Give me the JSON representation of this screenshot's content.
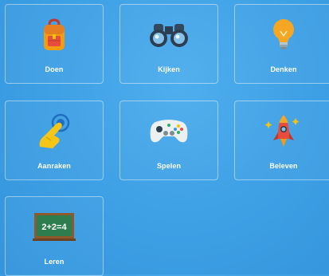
{
  "tiles": [
    {
      "label": "Doen",
      "icon": "backpack-icon"
    },
    {
      "label": "Kijken",
      "icon": "binoculars-icon"
    },
    {
      "label": "Denken",
      "icon": "lightbulb-icon"
    },
    {
      "label": "Aanraken",
      "icon": "touch-hand-icon"
    },
    {
      "label": "Spelen",
      "icon": "gamepad-icon"
    },
    {
      "label": "Beleven",
      "icon": "rocket-icon"
    },
    {
      "label": "Leren",
      "icon": "chalkboard-icon",
      "board_text": "2+2=4"
    }
  ],
  "colors": {
    "background": "#3d9fe4",
    "tile_border": "#ffffff",
    "label": "#ffffff"
  }
}
